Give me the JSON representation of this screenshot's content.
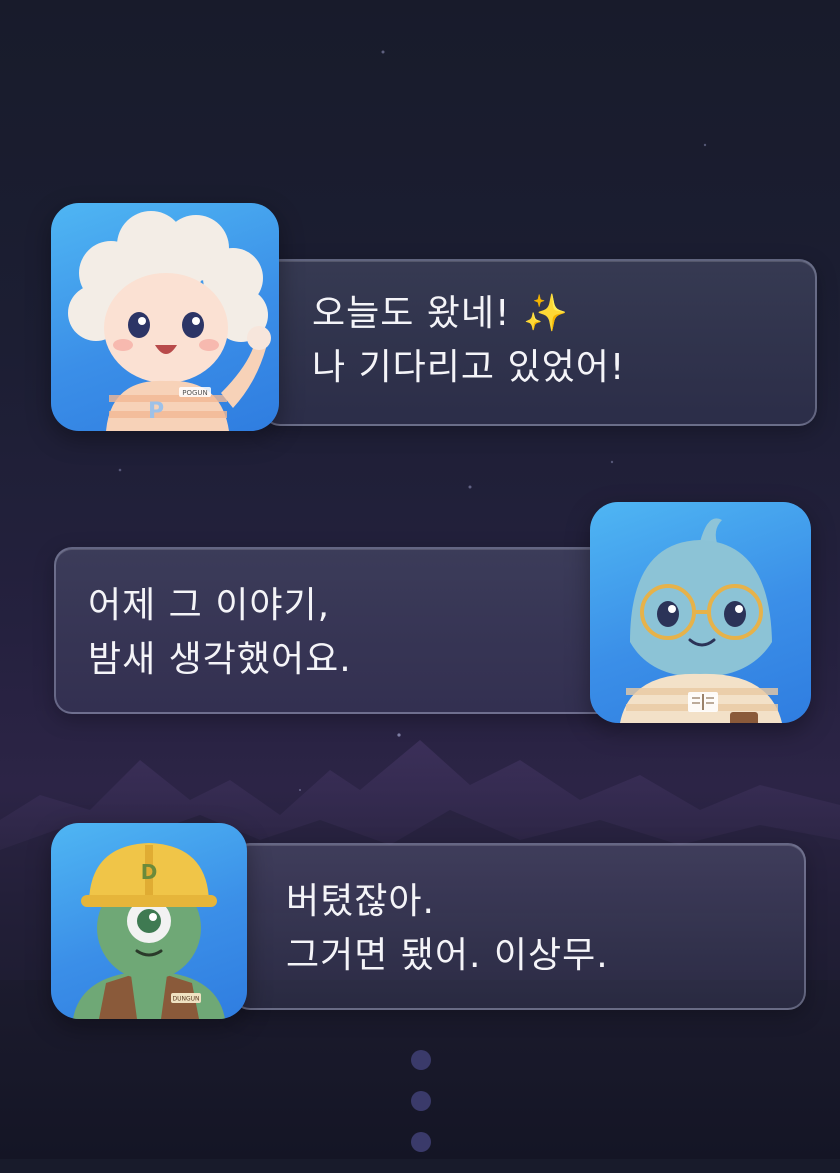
{
  "messages": [
    {
      "speaker": "pogun",
      "line1": "오늘도 왔네!",
      "emoji": "✨",
      "line2": "나 기다리고 있었어!",
      "badge": "POGUN"
    },
    {
      "speaker": "reader",
      "line1": "어제 그 이야기,",
      "line2": "밤새 생각했어요."
    },
    {
      "speaker": "dungun",
      "line1": "버텼잖아.",
      "line2": "그거면 됐어. 이상무.",
      "badge": "DUNGUN",
      "helmet_letter": "D"
    }
  ],
  "colors": {
    "background_top": "#181b2b",
    "background_mid": "#2c2446",
    "avatar_blue": "#3b8fe8",
    "text": "#f4f4f8",
    "dot": "#3a3a6a"
  },
  "icons": [
    "sparkles-icon",
    "book-icon"
  ],
  "page_indicator": {
    "count": 3
  }
}
